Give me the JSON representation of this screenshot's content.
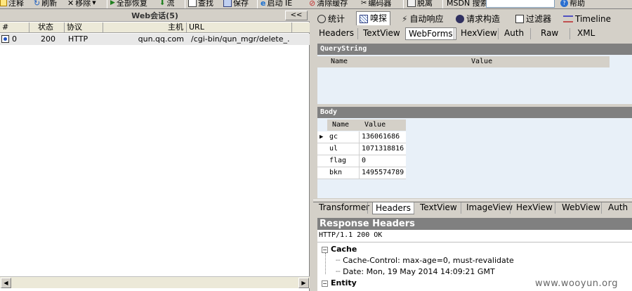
{
  "toolbar": {
    "comment": "注释",
    "refresh": "刷新",
    "remove": "移除",
    "resume_all": "全部恢复",
    "stream": "流",
    "find": "查找",
    "save": "保存",
    "launch_ie": "启动 IE",
    "clear_cache": "清除缓存",
    "encoder": "编码器",
    "tearoff": "脱离",
    "msdn_search": "MSDN 搜索",
    "help": "帮助"
  },
  "sessions": {
    "title": "Web会话(5)",
    "collapse": "<<",
    "columns": [
      "#",
      "状态",
      "协议",
      "主机",
      "URL"
    ],
    "rows": [
      {
        "id": "0",
        "status": "200",
        "protocol": "HTTP",
        "host": "qun.qq.com",
        "url": "/cgi-bin/qun_mgr/delete_..."
      }
    ]
  },
  "inspector": {
    "main_tabs": [
      "统计",
      "嗅探",
      "自动响应",
      "请求构造",
      "过滤器",
      "Timeline"
    ],
    "active_main_tab": "嗅探",
    "request_tabs": [
      "Headers",
      "TextView",
      "WebForms",
      "HexView",
      "Auth",
      "Raw",
      "XML"
    ],
    "active_request_tab": "WebForms",
    "querystring": {
      "title": "QueryString",
      "columns": [
        "Name",
        "Value"
      ]
    },
    "body": {
      "title": "Body",
      "columns": [
        "Name",
        "Value"
      ],
      "rows": [
        {
          "name": "gc",
          "value": "136061686"
        },
        {
          "name": "ul",
          "value": "1071318816"
        },
        {
          "name": "flag",
          "value": "0"
        },
        {
          "name": "bkn",
          "value": "1495574789"
        }
      ]
    },
    "response_tabs": [
      "Transformer",
      "Headers",
      "TextView",
      "ImageView",
      "HexView",
      "WebView",
      "Auth"
    ],
    "active_response_tab": "Headers",
    "response": {
      "title": "Response Headers",
      "status_line": "HTTP/1.1 200 OK",
      "groups": [
        {
          "name": "Cache",
          "items": [
            "Cache-Control: max-age=0, must-revalidate",
            "Date: Mon, 19 May 2014 14:09:21 GMT"
          ]
        },
        {
          "name": "Entity",
          "items": []
        }
      ]
    }
  },
  "watermark": "www.wooyun.org",
  "colors": {
    "panel": "#d4d0c8",
    "band": "#808080",
    "grid_bg": "#e8f0f8"
  }
}
